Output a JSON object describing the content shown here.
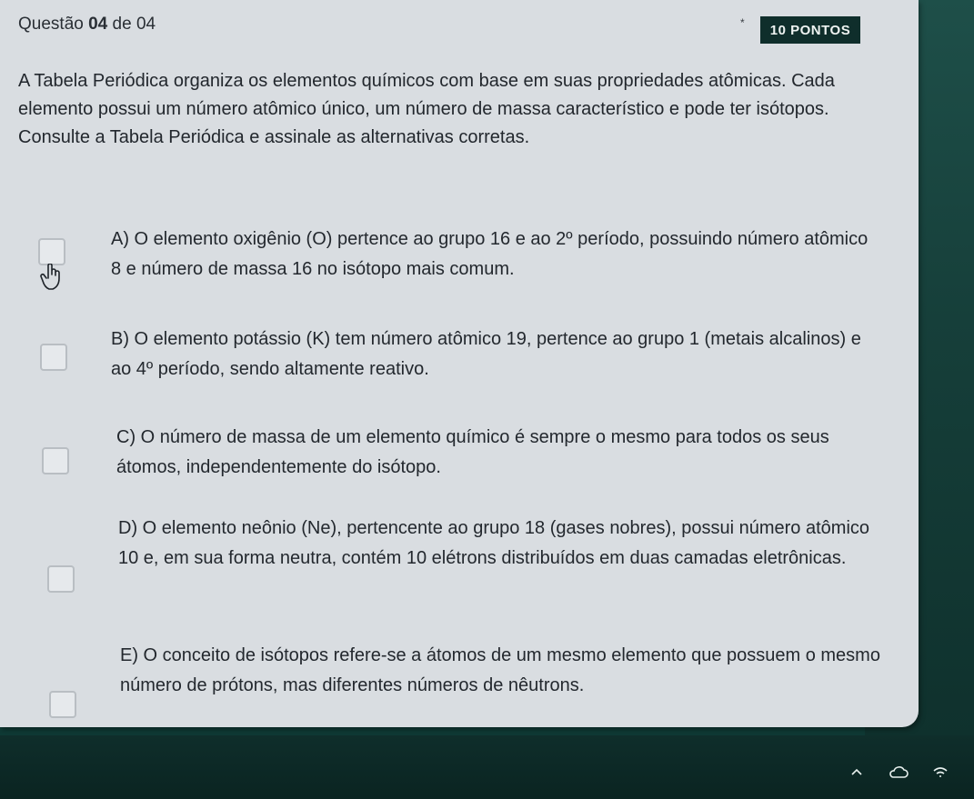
{
  "header": {
    "prefix": "Questão",
    "number": "04",
    "suffix": "de 04",
    "points": "10 PONTOS",
    "marker": "*"
  },
  "question_text": "A Tabela Periódica organiza os elementos químicos com base em suas propriedades atômicas. Cada elemento possui um número atômico único, um número de massa característico e pode ter isótopos. Consulte a Tabela Periódica e assinale as alternativas corretas.",
  "options": [
    {
      "text": "A) O elemento oxigênio (O) pertence ao grupo 16 e ao 2º período, possuindo número atômico 8 e número de massa 16 no isótopo mais comum.",
      "checked": false
    },
    {
      "text": "B) O elemento potássio (K) tem número atômico 19, pertence ao grupo 1 (metais alcalinos) e ao 4º período, sendo altamente reativo.",
      "checked": false
    },
    {
      "text": "C) O número de massa de um elemento químico é sempre o mesmo para todos os seus átomos, independentemente do isótopo.",
      "checked": false
    },
    {
      "text": "D) O elemento neônio (Ne), pertencente ao grupo 18 (gases nobres), possui número atômico 10 e, em sua forma neutra, contém 10 elétrons distribuídos em duas camadas eletrônicas.",
      "checked": false
    },
    {
      "text": "E) O conceito de isótopos refere-se a átomos de um mesmo elemento que possuem o mesmo número de prótons, mas diferentes números de nêutrons.",
      "checked": false
    }
  ],
  "icons": {
    "cursor": "hand-pointer-icon",
    "taskbar": [
      "chevron-up-icon",
      "cloud-icon",
      "wifi-icon"
    ]
  },
  "colors": {
    "card": "#d9dde1",
    "background": "#0f3a35",
    "badge": "#0f2e2b"
  }
}
